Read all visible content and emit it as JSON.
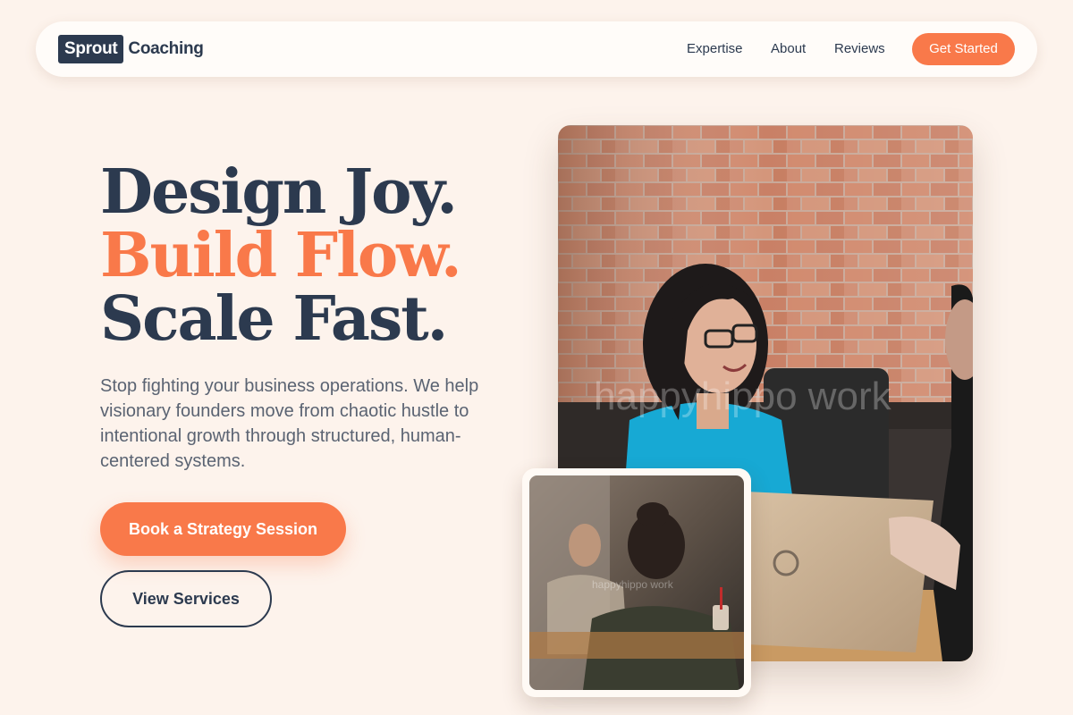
{
  "brand": {
    "logo_box": "Sprout",
    "logo_text": "Coaching"
  },
  "nav": {
    "links": [
      "Expertise",
      "About",
      "Reviews"
    ],
    "cta": "Get Started"
  },
  "hero": {
    "line1": "Design Joy.",
    "line2": "Build Flow.",
    "line3": "Scale Fast.",
    "subcopy": "Stop fighting your business operations. We help visionary founders move from chaotic hustle to intentional growth through structured, human-centered systems.",
    "primary_button": "Book a Strategy Session",
    "secondary_button": "View Services"
  },
  "images": {
    "main_watermark": "happyhippo work",
    "inset_watermark": "happyhippo work"
  },
  "colors": {
    "background": "#fdf3ec",
    "navy": "#2c3a4f",
    "accent": "#f9794a"
  }
}
